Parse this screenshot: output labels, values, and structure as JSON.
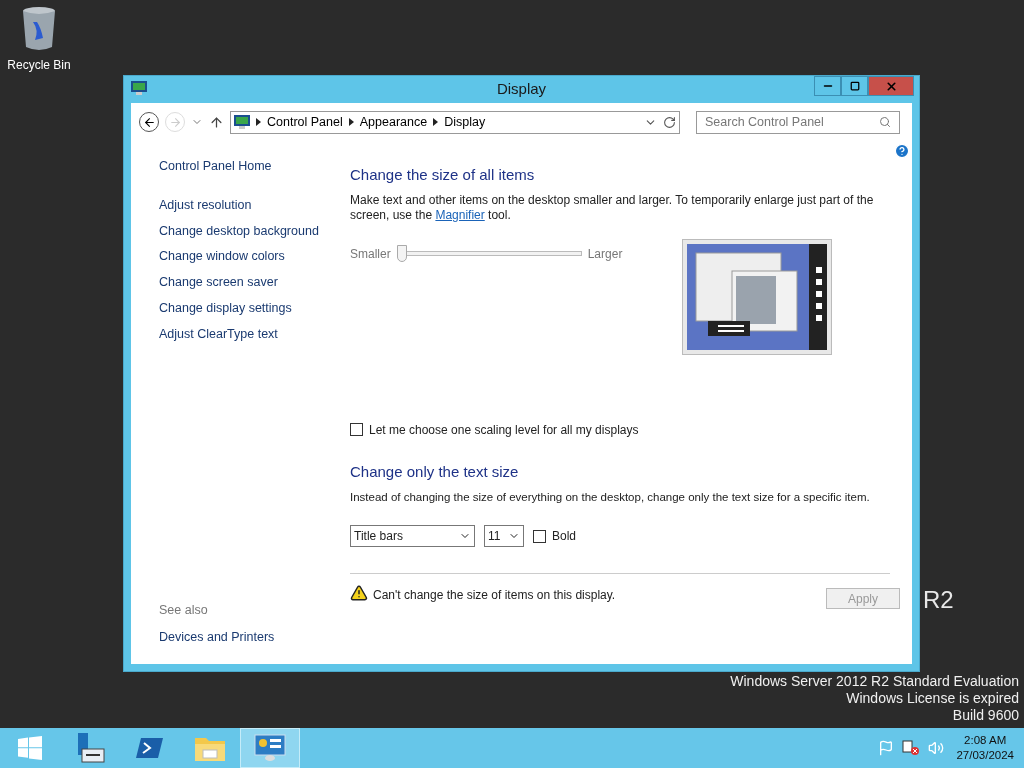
{
  "desktop": {
    "icons": [
      {
        "label": "Recycle Bin"
      }
    ],
    "brand": "R2",
    "watermark": [
      "Windows Server 2012 R2 Standard Evaluation",
      "Windows License is expired",
      "Build 9600"
    ]
  },
  "window": {
    "title": "Display",
    "breadcrumbs": [
      "Control Panel",
      "Appearance",
      "Display"
    ],
    "search": {
      "placeholder": "Search Control Panel"
    },
    "sidebar": {
      "home": "Control Panel Home",
      "links": [
        "Adjust resolution",
        "Change desktop background",
        "Change window colors",
        "Change screen saver",
        "Change display settings",
        "Adjust ClearType text"
      ],
      "see_also_heading": "See also",
      "see_also": [
        "Devices and Printers"
      ]
    },
    "size_section": {
      "heading": "Change the size of all items",
      "intro_before": "Make text and other items on the desktop smaller and larger. To temporarily enlarge just part of the screen, use the ",
      "link": "Magnifier",
      "intro_after": " tool.",
      "slider": {
        "min_label": "Smaller",
        "max_label": "Larger",
        "level": 0
      },
      "scaling_checkbox": {
        "label": "Let me choose one scaling level for all my displays",
        "checked": false
      }
    },
    "text_section": {
      "heading": "Change only the text size",
      "intro": "Instead of changing the size of everything on the desktop, change only the text size for a specific item.",
      "item_select": "Title bars",
      "size_select": "11",
      "bold": {
        "label": "Bold",
        "checked": false
      }
    },
    "warning": "Can't change the size of items on this display.",
    "apply": {
      "label": "Apply",
      "disabled": true
    }
  },
  "taskbar": {
    "apps": [
      {
        "kind": "start",
        "selected": false
      },
      {
        "kind": "server-manager",
        "selected": false
      },
      {
        "kind": "powershell",
        "selected": false
      },
      {
        "kind": "explorer",
        "selected": false
      },
      {
        "kind": "control-panel",
        "selected": true
      }
    ],
    "clock": {
      "time": "2:08 AM",
      "date": "27/03/2024"
    }
  }
}
